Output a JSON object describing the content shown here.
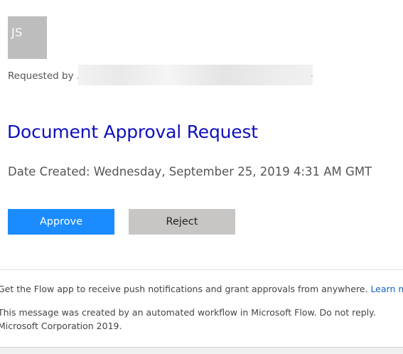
{
  "avatar": {
    "initials": "JS"
  },
  "requester": {
    "label": "Requested by .",
    "redacted_tail": "."
  },
  "request": {
    "title": "Document Approval Request",
    "date_created": "Date Created: Wednesday, September 25, 2019 4:31 AM GMT"
  },
  "actions": {
    "approve_label": "Approve",
    "reject_label": "Reject"
  },
  "footer": {
    "app_prompt": "Get the Flow app to receive push notifications and grant approvals from anywhere.",
    "learn_more_label": "Learn more",
    "automated_notice": "This message was created by an automated workflow in Microsoft Flow. Do not reply.",
    "copyright": "Microsoft Corporation 2019."
  },
  "colors": {
    "title": "#0f0fbf",
    "approve_button": "#1a8cff",
    "reject_button": "#c8c6c4",
    "link": "#1464c8",
    "avatar": "#bdbdbd"
  }
}
